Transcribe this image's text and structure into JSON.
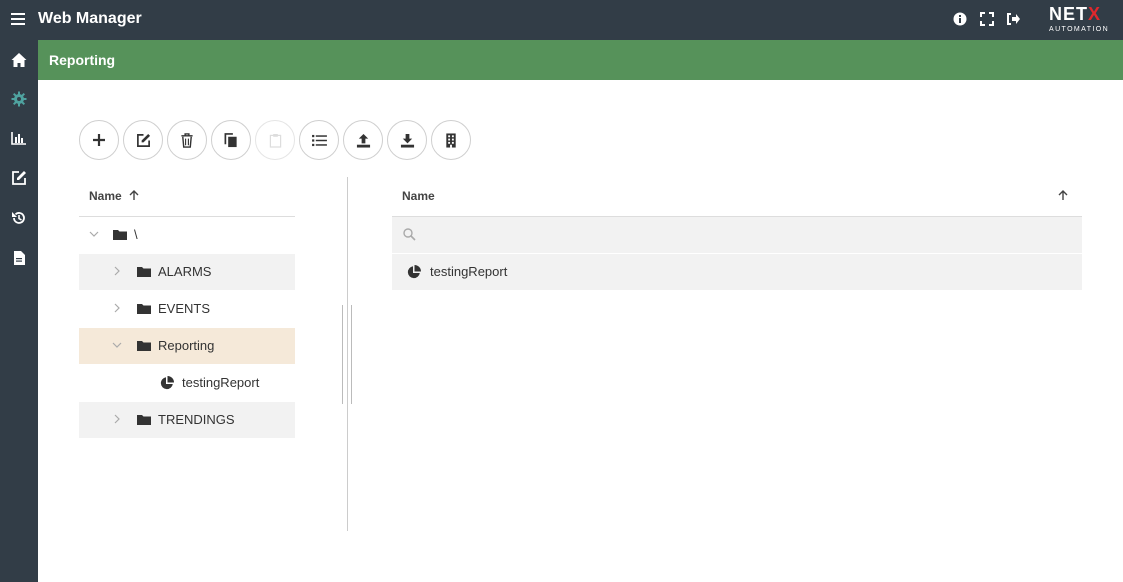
{
  "app": {
    "title": "Web Manager"
  },
  "logo": {
    "main": "NETX",
    "main_prefix": "NET",
    "main_accent": "X",
    "sub": "AUTOMATION",
    "accent_color": "#e0282d"
  },
  "topbar_icons": [
    "info-icon",
    "fullscreen-icon",
    "logout-icon"
  ],
  "sidebar": {
    "items": [
      {
        "icon": "home-icon"
      },
      {
        "icon": "gear-icon",
        "active": true
      },
      {
        "icon": "bar-chart-icon"
      },
      {
        "icon": "edit-icon"
      },
      {
        "icon": "history-icon"
      },
      {
        "icon": "document-icon"
      }
    ]
  },
  "page": {
    "title": "Reporting"
  },
  "toolbar": {
    "buttons": [
      {
        "icon": "plus-icon"
      },
      {
        "icon": "edit-icon"
      },
      {
        "icon": "trash-icon"
      },
      {
        "icon": "copy-icon"
      },
      {
        "icon": "paste-icon",
        "disabled": true
      },
      {
        "icon": "list-icon"
      },
      {
        "icon": "upload-icon"
      },
      {
        "icon": "download-icon"
      },
      {
        "icon": "building-icon"
      }
    ]
  },
  "tree": {
    "header": "Name",
    "root": "\\",
    "items": [
      {
        "label": "ALARMS",
        "expanded": false
      },
      {
        "label": "EVENTS",
        "expanded": false
      },
      {
        "label": "Reporting",
        "expanded": true,
        "selected": true
      },
      {
        "label": "testingReport",
        "type": "report"
      },
      {
        "label": "TRENDINGS",
        "expanded": false
      }
    ]
  },
  "list": {
    "header": "Name",
    "search": {
      "placeholder": "",
      "value": ""
    },
    "items": [
      {
        "label": "testingReport"
      }
    ]
  },
  "colors": {
    "topbar": "#323d47",
    "header": "#56925a",
    "selected_row": "#f5e9d9",
    "active_sidebar": "#4fa3a0"
  }
}
